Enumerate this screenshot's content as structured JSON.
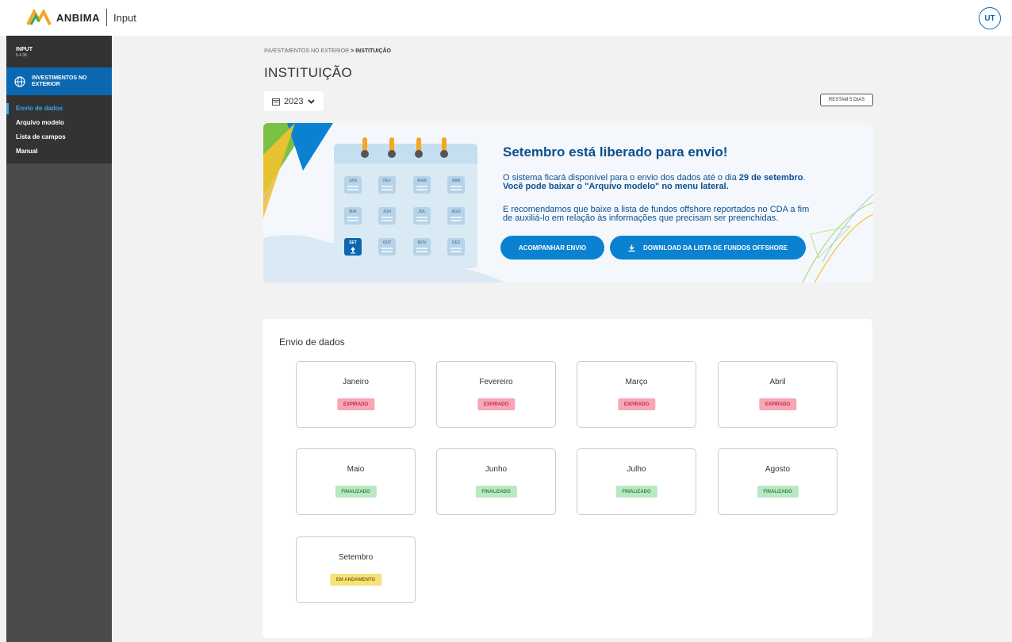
{
  "colors": {
    "primary": "#0b67b0",
    "accent": "#0b82d1",
    "expired": "#f6a7b4",
    "finished": "#b9e8c2",
    "in_progress": "#f5e27a"
  },
  "header": {
    "brand": "ANBIMA",
    "app": "Input",
    "avatar": "UT"
  },
  "sidebar": {
    "title": "INPUT",
    "version": "5.4.36",
    "module": "INVESTIMENTOS NO EXTERIOR",
    "items": [
      {
        "label": "Envio de dados"
      },
      {
        "label": "Arquivo modelo"
      },
      {
        "label": "Lista de campos"
      },
      {
        "label": "Manual"
      }
    ]
  },
  "breadcrumb": {
    "parent": "INVESTIMENTOS NO EXTERIOR",
    "sep": ">",
    "current": "INSTITUIÇÃO"
  },
  "page_title": "INSTITUIÇÃO",
  "year_selector": {
    "value": "2023"
  },
  "days_badge": "RESTAM 5 DIAS",
  "banner": {
    "title": "Setembro está liberado para envio!",
    "p1_prefix": "O sistema ficará disponível para o envio dos dados até o dia ",
    "p1_bold": "29 de setembro",
    "p1_suffix": ".",
    "p1_line2": "Você pode baixar o \"Arquivo modelo\" no menu lateral.",
    "p2": "E recomendamos que baixe a lista de fundos offshore reportados no CDA a fim de auxiliá-lo em relação às informações que precisam ser preenchidas.",
    "btn_track": "ACOMPANHAR ENVIO",
    "btn_download": "DOWNLOAD DA LISTA DE FUNDOS OFFSHORE",
    "calendar_months": [
      "JAN",
      "FEV",
      "MAR",
      "ABR",
      "MAI",
      "JUN",
      "JUL",
      "AGO",
      "SET",
      "OUT",
      "NOV",
      "DEZ"
    ]
  },
  "envio": {
    "title": "Envio de dados",
    "months": [
      {
        "name": "Janeiro",
        "status": "EXPIRADO"
      },
      {
        "name": "Fevereiro",
        "status": "EXPIRADO"
      },
      {
        "name": "Março",
        "status": "EXPIRADO"
      },
      {
        "name": "Abril",
        "status": "EXPIRADO"
      },
      {
        "name": "Maio",
        "status": "FINALIZADO"
      },
      {
        "name": "Junho",
        "status": "FINALIZADO"
      },
      {
        "name": "Julho",
        "status": "FINALIZADO"
      },
      {
        "name": "Agosto",
        "status": "FINALIZADO"
      },
      {
        "name": "Setembro",
        "status": "EM ANDAMENTO"
      }
    ]
  }
}
